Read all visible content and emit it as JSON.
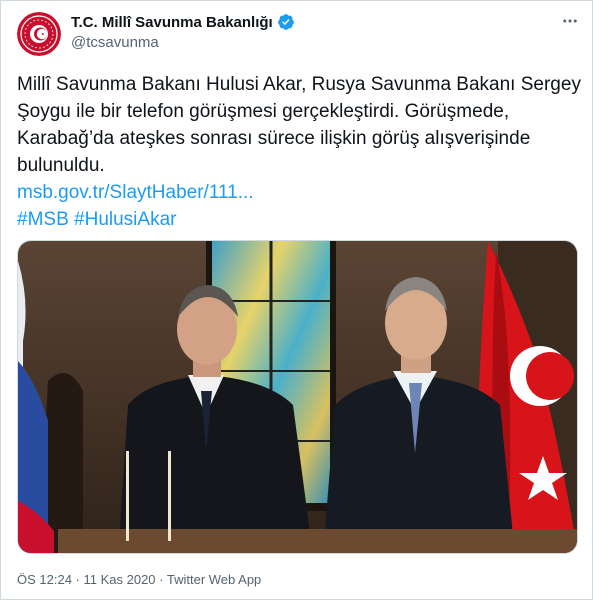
{
  "account": {
    "display_name": "T.C. Millî Savunma Bakanlığı",
    "handle": "@tcsavunma",
    "avatar_icon": "ministry-emblem-icon",
    "verified_icon": "verified-badge-icon"
  },
  "tweet": {
    "text": "Millî Savunma Bakanı Hulusi Akar, Rusya Savunma Bakanı Sergey Şoygu ile bir telefon görüşmesi gerçekleştirdi. Görüşmede, Karabağ’da ateşkes sonrası sürece ilişkin görüş alışverişinde bulunuldu.",
    "link": "msb.gov.tr/SlaytHaber/111...",
    "hashtag_1": "#MSB",
    "hashtag_2": "#HulusiAkar"
  },
  "media": {
    "flag_left_icon": "russian-flag",
    "flag_right_icon": "turkish-flag"
  },
  "meta": {
    "time": "ÖS 12:24",
    "sep1": " · ",
    "date": "11 Kas 2020",
    "sep2": " · ",
    "source": "Twitter Web App"
  },
  "colors": {
    "link": "#1d9bf0",
    "text": "#0f1419",
    "secondary": "#536471",
    "emblem_red": "#c8102e"
  }
}
